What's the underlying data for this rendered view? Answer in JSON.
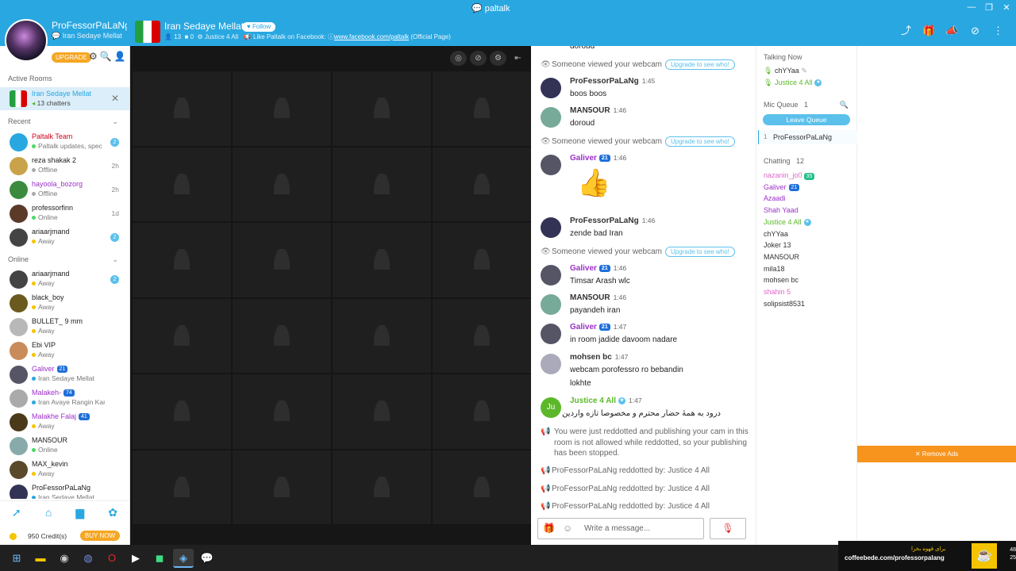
{
  "window": {
    "logo": "paltalk",
    "min": "—",
    "max": "❐",
    "close": "✕"
  },
  "user": {
    "name": "ProFessorPaLaNg",
    "room": "Iran Sedaye Mellat",
    "upgrade_label": "UPGRADE"
  },
  "room": {
    "title": "Iran Sedaye Mellat",
    "follow_label": "Follow",
    "users_count": "13",
    "cams_count": "0",
    "owner": "Justice 4 All",
    "like_text": "Like Paltalk on Facebook:",
    "fb_link": "www.facebook.com/paltalk",
    "fb_suffix": "(Official Page)"
  },
  "sidebar": {
    "active_rooms_title": "Active Rooms",
    "active_room": {
      "name": "Iran Sedaye Mellat",
      "count": "13 chatters"
    },
    "recent_title": "Recent",
    "recent": [
      {
        "name": "Paltalk Team",
        "status": "Paltalk updates, spec",
        "badge": "2",
        "time": "",
        "color": "#d0021b",
        "avatar": "#29a7e1",
        "dot": "#4cd964"
      },
      {
        "name": "reza shakak 2",
        "status": "Offline",
        "badge": "",
        "time": "2h",
        "color": "#222",
        "avatar": "#c9a24a",
        "dot": "#aaa"
      },
      {
        "name": "hayoola_bozorg",
        "status": "Offline",
        "badge": "",
        "time": "2h",
        "color": "#9b30c8",
        "avatar": "#3a8b3e",
        "dot": "#aaa"
      },
      {
        "name": "professorfinn",
        "status": "Online",
        "badge": "",
        "time": "1d",
        "color": "#222",
        "avatar": "#5b3a29",
        "dot": "#4cd964"
      },
      {
        "name": "ariaarjmand",
        "status": "Away",
        "badge": "2",
        "time": "",
        "color": "#222",
        "avatar": "#444",
        "dot": "#f5c400"
      }
    ],
    "online_title": "Online",
    "online": [
      {
        "name": "ariaarjmand",
        "status": "Away",
        "badge": "2",
        "level": "",
        "color": "#222",
        "avatar": "#444",
        "dot": "#f5c400"
      },
      {
        "name": "black_boy",
        "status": "Away",
        "badge": "",
        "level": "",
        "color": "#222",
        "avatar": "#6b5a1e",
        "dot": "#f5c400"
      },
      {
        "name": "BULLET_ 9 mm",
        "status": "Away",
        "badge": "",
        "level": "",
        "color": "#222",
        "avatar": "#b8b8b8",
        "dot": "#f5c400"
      },
      {
        "name": "Ebi VIP",
        "status": "Away",
        "badge": "",
        "level": "",
        "color": "#222",
        "avatar": "#c98b5a",
        "dot": "#f5c400"
      },
      {
        "name": "Galiver",
        "status": "Iran Sedaye Mellat",
        "badge": "",
        "level": "21",
        "color": "#9b30c8",
        "avatar": "#556",
        "dot": "#29a7e1"
      },
      {
        "name": "Malakeh-",
        "status": "Iran Avaye Rangin Kaman",
        "badge": "",
        "level": "74",
        "color": "#9b30c8",
        "avatar": "#aaa",
        "dot": "#29a7e1"
      },
      {
        "name": "Malakhe Falaj",
        "status": "Away",
        "badge": "",
        "level": "41",
        "color": "#9b30c8",
        "avatar": "#4a3a1a",
        "dot": "#f5c400"
      },
      {
        "name": "MAN5OUR",
        "status": "Online",
        "badge": "",
        "level": "",
        "color": "#222",
        "avatar": "#8aa",
        "dot": "#4cd964"
      },
      {
        "name": "MAX_kevin",
        "status": "Away",
        "badge": "",
        "level": "",
        "color": "#222",
        "avatar": "#5a4a2a",
        "dot": "#f5c400"
      },
      {
        "name": "ProFessorPaLaNg",
        "status": "Iran Sedaye Mellat",
        "badge": "",
        "level": "",
        "color": "#222",
        "avatar": "#335",
        "dot": "#29a7e1"
      }
    ],
    "credits": "950 Credit(s)",
    "buy_label": "BUY NOW"
  },
  "chat": {
    "top_partial": "doroud",
    "webcam_notice": "Someone viewed your webcam",
    "upgrade_see": "Upgrade to see who!",
    "messages": [
      {
        "name": "ProFessorPaLaNg",
        "time": "1:45",
        "text": "boos boos"
      },
      {
        "name": "MAN5OUR",
        "time": "1:46",
        "text": "doroud"
      },
      {
        "name": "Galiver",
        "time": "1:46",
        "level": "21",
        "text": ""
      },
      {
        "name": "ProFessorPaLaNg",
        "time": "1:46",
        "text": "zende bad Iran"
      },
      {
        "name": "Galiver",
        "time": "1:46",
        "level": "21",
        "text": "Timsar Arash wlc"
      },
      {
        "name": "MAN5OUR",
        "time": "1:46",
        "text": "payandeh iran"
      },
      {
        "name": "Galiver",
        "time": "1:47",
        "level": "21",
        "text": "in room jadide davoom nadare"
      },
      {
        "name": "mohsen bc",
        "time": "1:47",
        "text": "webcam porofessro ro bebandin",
        "text2": "lokhte"
      },
      {
        "name": "Justice 4 All",
        "time": "1:47",
        "initials": "Ju",
        "text": "درود به همهٔ حضار محترم و مخصوصا تازه واردین"
      }
    ],
    "reddot_notice": "You were just reddotted and publishing your cam in this room is not allowed while reddotted, so your publishing has been stopped.",
    "reddot_lines": [
      "ProFessorPaLaNg reddotted by: Justice 4 All",
      "ProFessorPaLaNg reddotted by: Justice 4 All",
      "ProFessorPaLaNg reddotted by: Justice 4 All"
    ],
    "input_placeholder": "Write a message..."
  },
  "userlist": {
    "talking_title": "Talking Now",
    "talking": [
      "chYYaa",
      "Justice 4 All"
    ],
    "queue_title": "Mic Queue",
    "queue_count": "1",
    "leave_label": "Leave Queue",
    "queue": [
      "ProFessorPaLaNg"
    ],
    "chatting_title": "Chatting",
    "chatting_count": "12",
    "chatting": [
      {
        "name": "nazanin_jo0",
        "color": "#e066c8"
      },
      {
        "name": "Galiver",
        "color": "#9b30c8"
      },
      {
        "name": "Azaadi",
        "color": "#9b30c8"
      },
      {
        "name": "Shah Yaad",
        "color": "#9b30c8"
      },
      {
        "name": "Justice 4 All",
        "color": "#5cb82a"
      },
      {
        "name": "chYYaa",
        "color": "#333"
      },
      {
        "name": "Joker 13",
        "color": "#333"
      },
      {
        "name": "MAN5OUR",
        "color": "#333"
      },
      {
        "name": "mila18",
        "color": "#333"
      },
      {
        "name": "mohsen bc",
        "color": "#333"
      },
      {
        "name": "shahin 5",
        "color": "#e066c8"
      },
      {
        "name": "solipsist8531",
        "color": "#333"
      }
    ],
    "nazanin_gem": "35",
    "galiver_level": "21"
  },
  "ads": {
    "remove_label": "✕ Remove Ads"
  },
  "promo": {
    "title": "برای قهوه بخرا",
    "url": "coffeebede.com/professorpalang"
  },
  "clock": {
    "line1": "48",
    "line2": "25"
  }
}
